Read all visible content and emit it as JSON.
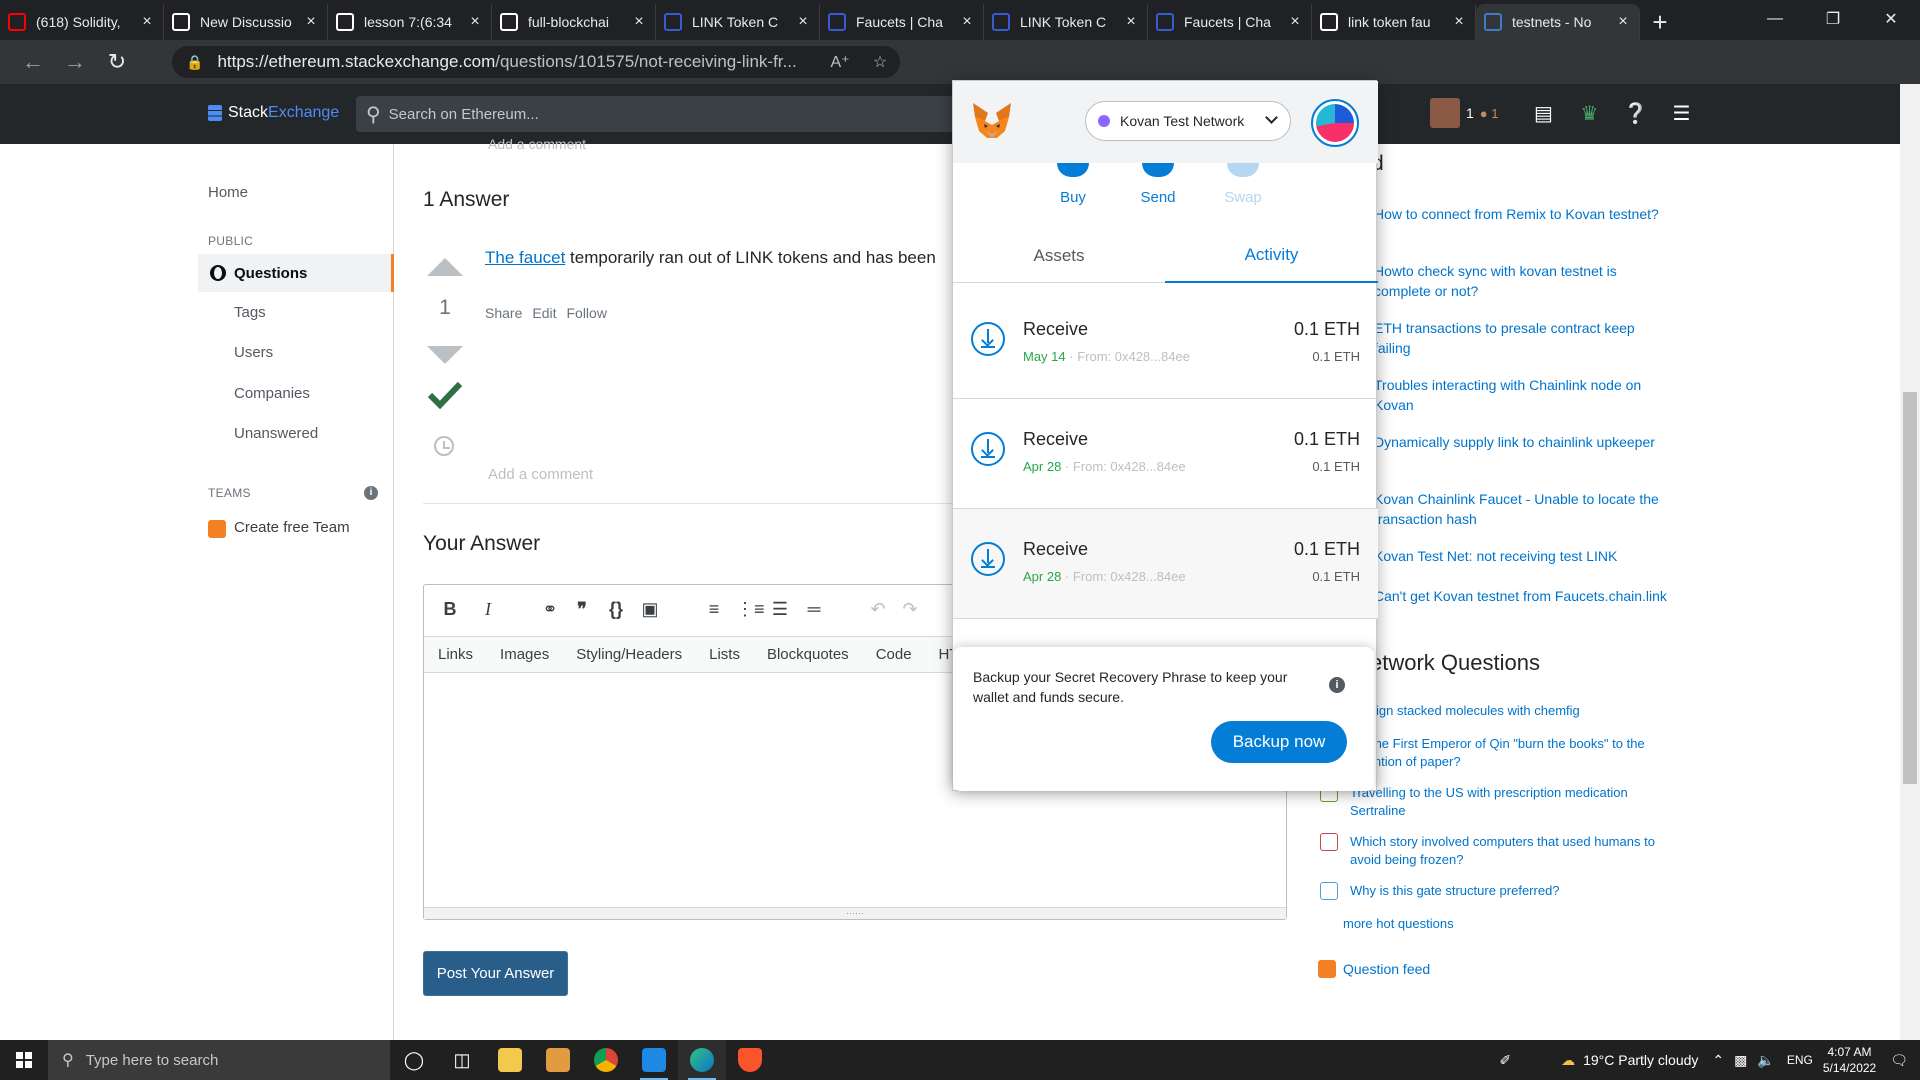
{
  "browser": {
    "tabs": [
      {
        "title": "(618) Solidity,",
        "icon": "youtube-icon",
        "color": "#ff0000"
      },
      {
        "title": "New Discussio",
        "icon": "github-icon",
        "color": "#ffffff"
      },
      {
        "title": "lesson 7:(6:34",
        "icon": "github-icon",
        "color": "#ffffff"
      },
      {
        "title": "full-blockchai",
        "icon": "github-icon",
        "color": "#ffffff"
      },
      {
        "title": "LINK Token C",
        "icon": "chainlink-icon",
        "color": "#375bd2"
      },
      {
        "title": "Faucets | Cha",
        "icon": "chainlink-icon",
        "color": "#375bd2"
      },
      {
        "title": "LINK Token C",
        "icon": "chainlink-icon",
        "color": "#375bd2"
      },
      {
        "title": "Faucets | Cha",
        "icon": "chainlink-icon",
        "color": "#375bd2"
      },
      {
        "title": "link token fau",
        "icon": "google-icon",
        "color": "#ffffff"
      },
      {
        "title": "testnets - No",
        "icon": "ethereum-se-icon",
        "color": "#3d7ec8"
      }
    ],
    "url_host": "https://ethereum.stackexchange.com",
    "url_path": "/questions/101575/not-receiving-link-fr..."
  },
  "se": {
    "logo_stack": "Stack",
    "logo_exchange": "Exchange",
    "search_placeholder": "Search on Ethereum...",
    "rep": "1",
    "bronze": "● 1"
  },
  "leftnav": {
    "home": "Home",
    "public": "PUBLIC",
    "questions": "Questions",
    "tags": "Tags",
    "users": "Users",
    "companies": "Companies",
    "unanswered": "Unanswered",
    "teams": "TEAMS",
    "create_team": "Create free Team"
  },
  "main": {
    "add_comment_top": "Add a comment",
    "answers_header": "1 Answer",
    "vote_count": "1",
    "answer_link": "The faucet",
    "answer_text": " temporarily ran out of LINK tokens and has been",
    "share": "Share",
    "edit": "Edit",
    "follow": "Follow",
    "add_comment": "Add a comment",
    "your_answer": "Your Answer",
    "help_tabs": [
      "Links",
      "Images",
      "Styling/Headers",
      "Lists",
      "Blockquotes",
      "Code",
      "HTML"
    ],
    "post_button": "Post Your Answer"
  },
  "right": {
    "linked_header": "d",
    "linked": [
      "How to connect from Remix to Kovan testnet?",
      "Howto check sync with kovan testnet is complete or not?",
      "ETH transactions to presale contract keep failing",
      "Troubles interacting with Chainlink node on Kovan",
      "Dynamically supply link to chainlink upkeeper",
      "Kovan Chainlink Faucet - Unable to locate the transaction hash",
      "Kovan Test Net: not receiving test LINK",
      "Can't get Kovan testnet from Faucets.chain.link"
    ],
    "hnq_header": "etwork Questions",
    "hnq": [
      {
        "text": "er-align stacked molecules with chemfig",
        "icon": "tex-icon",
        "color": "#ffffff"
      },
      {
        "text": "did the First Emperor of Qin \"burn the books\" to the invention of paper?",
        "icon": "history-icon",
        "color": "#ffffff"
      },
      {
        "text": "Travelling to the US with prescription medication Sertraline",
        "icon": "travel-icon",
        "color": "#5f9e3a"
      },
      {
        "text": "Which story involved computers that used humans to avoid being frozen?",
        "icon": "scifi-icon",
        "color": "#c04848"
      },
      {
        "text": "Why is this gate structure preferred?",
        "icon": "electronics-icon",
        "color": "#4aa3df"
      }
    ],
    "more_hot": "more hot questions",
    "question_feed": "Question feed"
  },
  "metamask": {
    "network": "Kovan Test Network",
    "actions": {
      "buy": "Buy",
      "send": "Send",
      "swap": "Swap"
    },
    "tabs": {
      "assets": "Assets",
      "activity": "Activity"
    },
    "transactions": [
      {
        "title": "Receive",
        "date": "May 14",
        "from": " · From: 0x428...84ee",
        "amount": "0.1 ETH",
        "amount2": "0.1 ETH"
      },
      {
        "title": "Receive",
        "date": "Apr 28",
        "from": " · From: 0x428...84ee",
        "amount": "0.1 ETH",
        "amount2": "0.1 ETH"
      },
      {
        "title": "Receive",
        "date": "Apr 28",
        "from": " · From: 0x428...84ee",
        "amount": "0.1 ETH",
        "amount2": "0.1 ETH"
      }
    ],
    "backup_msg": "Backup your Secret Recovery Phrase to keep your wallet and funds secure.",
    "backup_button": "Backup now"
  },
  "taskbar": {
    "search_placeholder": "Type here to search",
    "weather": "19°C  Partly cloudy",
    "lang": "ENG",
    "time": "4:07 AM",
    "date": "5/14/2022"
  }
}
